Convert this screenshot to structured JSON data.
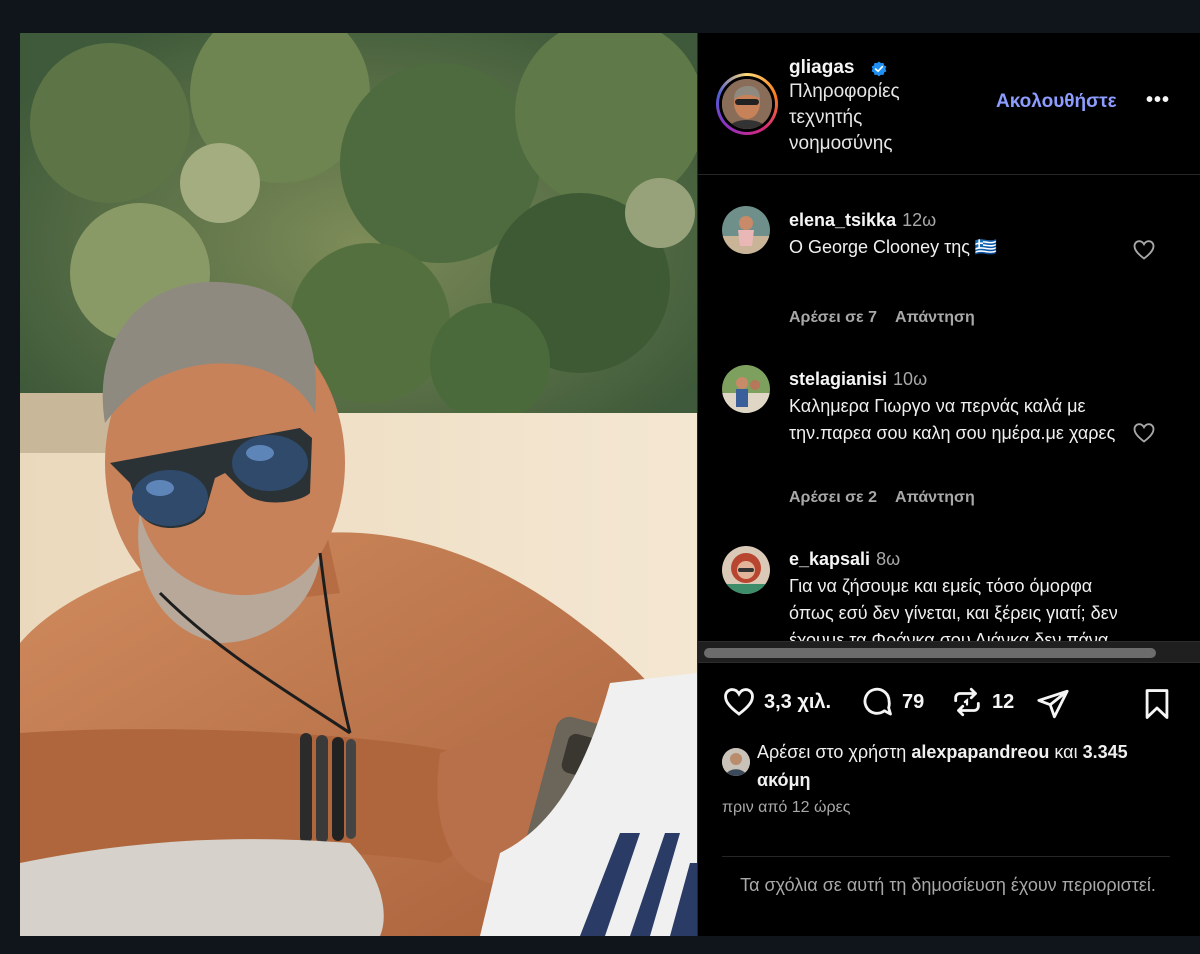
{
  "post": {
    "author": {
      "username": "gliagas",
      "subtitle": "Πληροφορίες τεχνητής νοημοσύνης",
      "verified": true,
      "follow_label": "Ακολουθήστε",
      "more_label": "•••"
    },
    "comments": [
      {
        "username": "elena_tsikka",
        "time": "12ω",
        "text": "Ο George Clooney της 🇬🇷",
        "likes_label": "Αρέσει σε 7",
        "reply_label": "Απάντηση"
      },
      {
        "username": "stelagianisi",
        "time": "10ω",
        "text": "Καλημερα Γιωργο να περνάς καλά με την.παρεα σου καλη σου ημέρα.με χαρες",
        "likes_label": "Αρέσει σε 2",
        "reply_label": "Απάντηση"
      },
      {
        "username": "e_kapsali",
        "time": "8ω",
        "text": "Για να ζήσουμε και εμείς τόσο όμορφα όπως εσύ δεν γίνεται, και ξέρεις γιατί; δεν έχουμε τα Φράνκα σου Λιάνκα δεν πάνα"
      }
    ],
    "actions": {
      "likes_count": "3,3 χιλ.",
      "comments_count": "79",
      "reposts_count": "12"
    },
    "liked_by": {
      "prefix": "Αρέσει στο χρήστη",
      "user": "alexpapandreou",
      "connector": "και",
      "others": "3.345 ακόμη"
    },
    "time_ago": "πριν από 12 ώρες",
    "comments_restricted": "Τα σχόλια σε αυτή τη δημοσίευση έχουν περιοριστεί.",
    "icons": [
      "heart-icon",
      "comment-icon",
      "repost-icon",
      "share-icon",
      "bookmark-icon",
      "verified-badge-icon",
      "more-icon"
    ],
    "colors": {
      "background": "#000000",
      "link_accent": "#8c9cff",
      "verified": "#1f8ff5",
      "muted_text": "#a8a8a8"
    }
  }
}
